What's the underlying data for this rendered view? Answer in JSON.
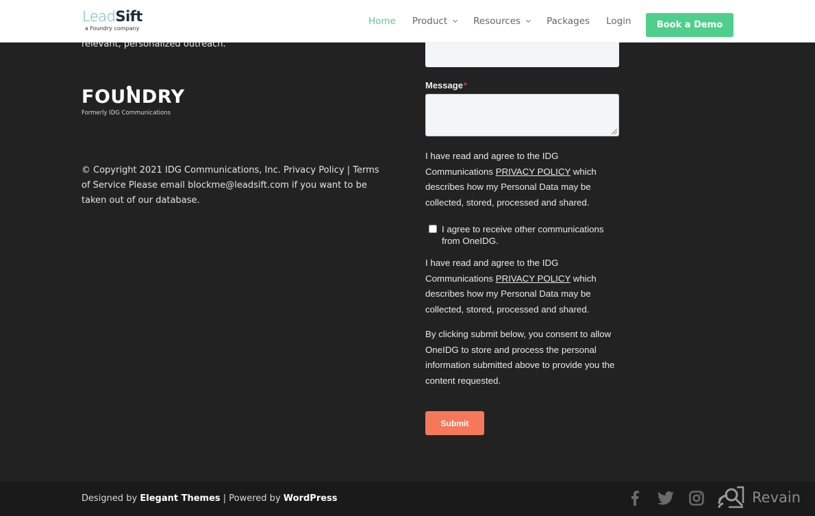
{
  "header": {
    "logo_primary": "Lead",
    "logo_secondary": "Sift",
    "logo_tagline": "a Foundry company",
    "nav": [
      {
        "label": "Home",
        "active": true,
        "dropdown": false
      },
      {
        "label": "Product",
        "active": false,
        "dropdown": true
      },
      {
        "label": "Resources",
        "active": false,
        "dropdown": true
      },
      {
        "label": "Packages",
        "active": false,
        "dropdown": false
      },
      {
        "label": "Login",
        "active": false,
        "dropdown": false
      }
    ],
    "cta_label": "Book a Demo",
    "colors": {
      "accent": "#4fcf8c",
      "active_nav": "#5cc891"
    }
  },
  "left": {
    "tagline_fragment": "relevant, personalized outreach.",
    "foundry_logo": "FOUNDRY",
    "foundry_sub": "Formerly IDG Communications",
    "copyright": "© Copyright 2021 IDG Communications, Inc. Privacy Policy   |   Terms of Service   Please email blockme@leadsift.com if you want to be taken out of our database."
  },
  "form": {
    "top_input_value": "",
    "message_label": "Message",
    "required_marker": "*",
    "message_value": "",
    "consent_1_prefix": "I have read and agree to the IDG Communications ",
    "consent_1_link": "PRIVACY POLICY",
    "consent_1_suffix": " which describes how my Personal Data may be collected, stored, processed and shared.",
    "checkbox_label": "I agree to receive other communications from OneIDG.",
    "checkbox_checked": false,
    "consent_2_prefix": "I have read and agree to the IDG Communications ",
    "consent_2_link": "PRIVACY POLICY",
    "consent_2_suffix": " which describes how my Personal Data may be collected, stored, processed and shared.",
    "submit_notice": "By clicking submit below, you consent to allow OneIDG to store and process the personal information submitted above to provide you the content requested.",
    "submit_label": "Submit",
    "submit_color": "#f5785a"
  },
  "footer": {
    "designed_by": "Designed by ",
    "designer": "Elegant Themes",
    "separator": " | Powered by ",
    "platform": "WordPress",
    "socials": [
      "facebook-icon",
      "twitter-icon",
      "instagram-icon"
    ],
    "watermark": "Revain"
  }
}
